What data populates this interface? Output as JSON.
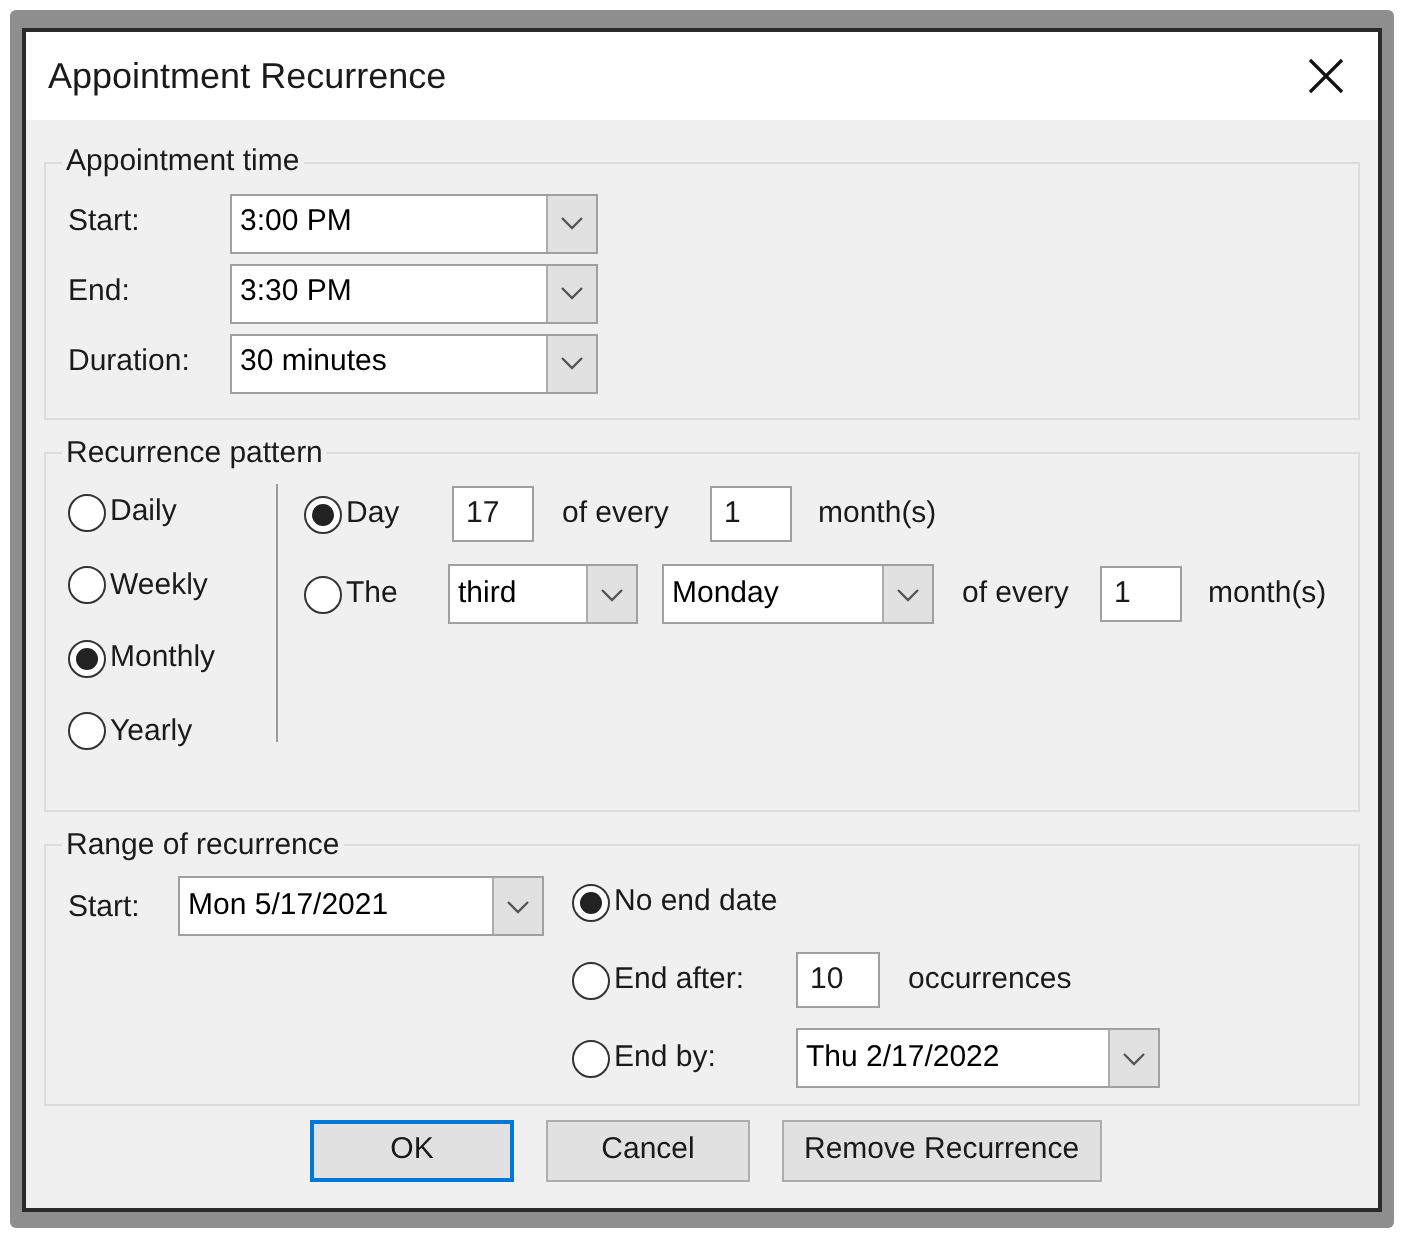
{
  "window": {
    "title": "Appointment Recurrence"
  },
  "appointment_time": {
    "title": "Appointment time",
    "fields": [
      {
        "label": "Start:",
        "value": "3:00 PM"
      },
      {
        "label": "End:",
        "value": "3:30 PM"
      },
      {
        "label": "Duration:",
        "value": "30 minutes"
      }
    ]
  },
  "recurrence_pattern": {
    "title": "Recurrence pattern",
    "frequencies": [
      {
        "label": "Daily",
        "selected": false
      },
      {
        "label": "Weekly",
        "selected": false
      },
      {
        "label": "Monthly",
        "selected": true
      },
      {
        "label": "Yearly",
        "selected": false
      }
    ],
    "day_option": {
      "label": "Day",
      "selected": true,
      "day": "17",
      "of_every": "of every",
      "months": "1",
      "unit": "month(s)"
    },
    "the_option": {
      "label": "The",
      "selected": false,
      "ordinal": "third",
      "weekday": "Monday",
      "of_every": "of every",
      "months": "1",
      "unit": "month(s)"
    }
  },
  "range": {
    "title": "Range of recurrence",
    "start_label": "Start:",
    "start": "Mon 5/17/2021",
    "end_options": [
      {
        "kind": "none",
        "label": "No end date",
        "selected": true
      },
      {
        "kind": "after",
        "label": "End after:",
        "selected": false,
        "value": "10",
        "unit": "occurrences"
      },
      {
        "kind": "by",
        "label": "End by:",
        "selected": false,
        "value": "Thu 2/17/2022"
      }
    ]
  },
  "buttons": [
    {
      "label": "OK",
      "default": true
    },
    {
      "label": "Cancel",
      "default": false
    },
    {
      "label": "Remove Recurrence",
      "default": false
    }
  ]
}
